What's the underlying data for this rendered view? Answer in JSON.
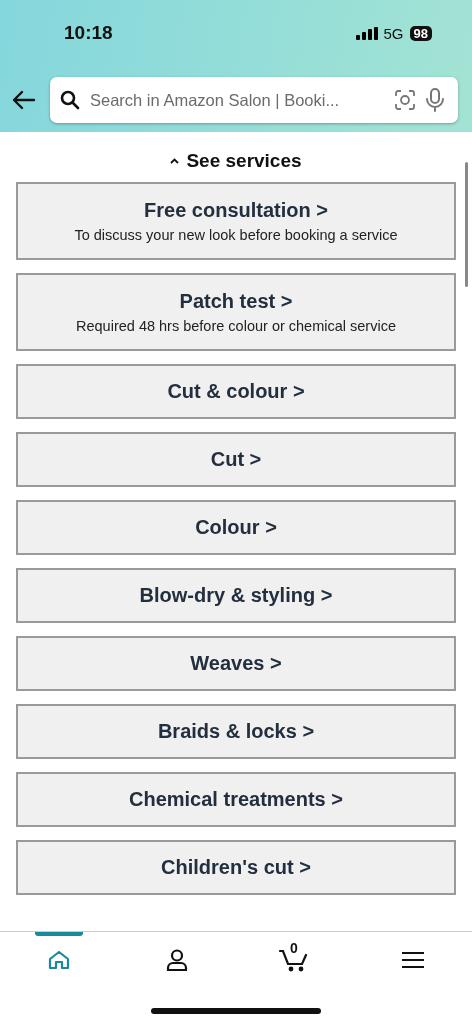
{
  "status_bar": {
    "time": "10:18",
    "network": "5G",
    "battery": "98"
  },
  "search": {
    "placeholder": "Search in Amazon Salon | Booki..."
  },
  "section_toggle": {
    "label": "See services",
    "expanded": true
  },
  "services": [
    {
      "title": "Free consultation >",
      "subtitle": "To discuss your new look before booking a service"
    },
    {
      "title": "Patch test >",
      "subtitle": "Required 48 hrs before colour or chemical service"
    },
    {
      "title": "Cut & colour >"
    },
    {
      "title": "Cut >"
    },
    {
      "title": "Colour >"
    },
    {
      "title": "Blow-dry & styling >"
    },
    {
      "title": "Weaves >"
    },
    {
      "title": "Braids & locks >"
    },
    {
      "title": "Chemical treatments >"
    },
    {
      "title": "Children's cut >"
    }
  ],
  "bottom_nav": [
    {
      "kind": "home",
      "selected": true
    },
    {
      "kind": "account",
      "selected": false
    },
    {
      "kind": "cart",
      "selected": false,
      "count": "0"
    },
    {
      "kind": "menu",
      "selected": false
    }
  ]
}
